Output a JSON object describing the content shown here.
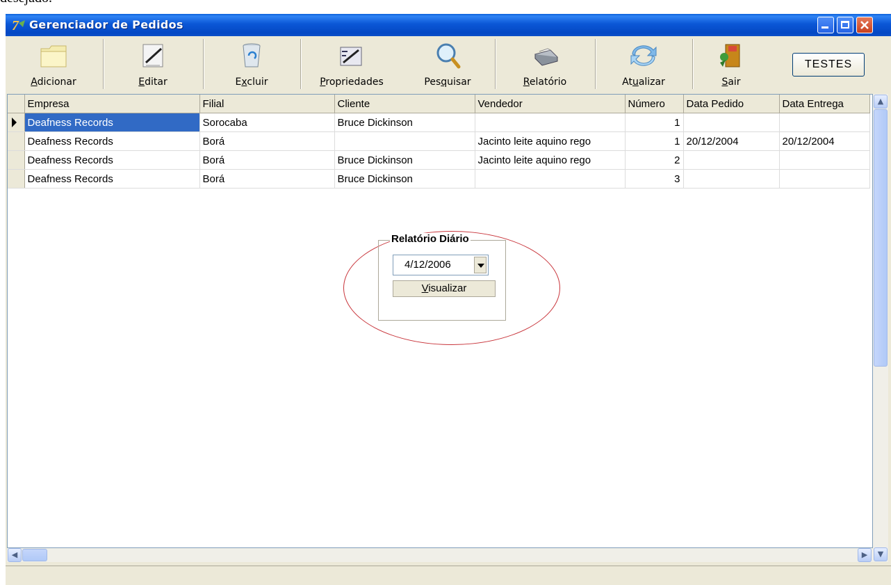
{
  "doc_fragment": "desejado.",
  "window": {
    "title": "Gerenciador de Pedidos"
  },
  "toolbar": {
    "items": [
      {
        "pre": "",
        "u": "A",
        "post": "dicionar",
        "icon": "folder-icon"
      },
      {
        "pre": "",
        "u": "E",
        "post": "ditar",
        "icon": "edit-document-icon"
      },
      {
        "pre": "E",
        "u": "x",
        "post": "cluir",
        "icon": "recycle-bin-icon"
      },
      {
        "pre": "",
        "u": "P",
        "post": "ropriedades",
        "icon": "properties-icon"
      },
      {
        "pre": "Pes",
        "u": "q",
        "post": "uisar",
        "icon": "magnifier-icon"
      },
      {
        "pre": "",
        "u": "R",
        "post": "elatório",
        "icon": "printer-icon"
      },
      {
        "pre": "At",
        "u": "u",
        "post": "alizar",
        "icon": "refresh-icon"
      },
      {
        "pre": "",
        "u": "S",
        "post": "air",
        "icon": "exit-door-icon"
      }
    ],
    "testes_label": "TESTES"
  },
  "grid": {
    "columns": [
      "Empresa",
      "Filial",
      "Cliente",
      "Vendedor",
      "Número",
      "Data Pedido",
      "Data Entrega"
    ],
    "rows": [
      [
        "Deafness Records",
        "Sorocaba",
        "Bruce Dickinson",
        "",
        "1",
        "",
        ""
      ],
      [
        "Deafness Records",
        "Borá",
        "",
        "Jacinto leite aquino rego",
        "1",
        "20/12/2004",
        "20/12/2004"
      ],
      [
        "Deafness Records",
        "Borá",
        "Bruce Dickinson",
        "Jacinto leite aquino rego",
        "2",
        "",
        ""
      ],
      [
        "Deafness Records",
        "Borá",
        "Bruce Dickinson",
        "",
        "3",
        "",
        ""
      ]
    ]
  },
  "report_panel": {
    "title": "Relatório Diário",
    "date_value": "4/12/2006",
    "view_button_underlined": "V",
    "view_button_rest": "isualizar"
  },
  "colors": {
    "selection": "#316ac5",
    "highlight_ellipse": "#c8343a",
    "titlebar": "#0b57d6"
  }
}
